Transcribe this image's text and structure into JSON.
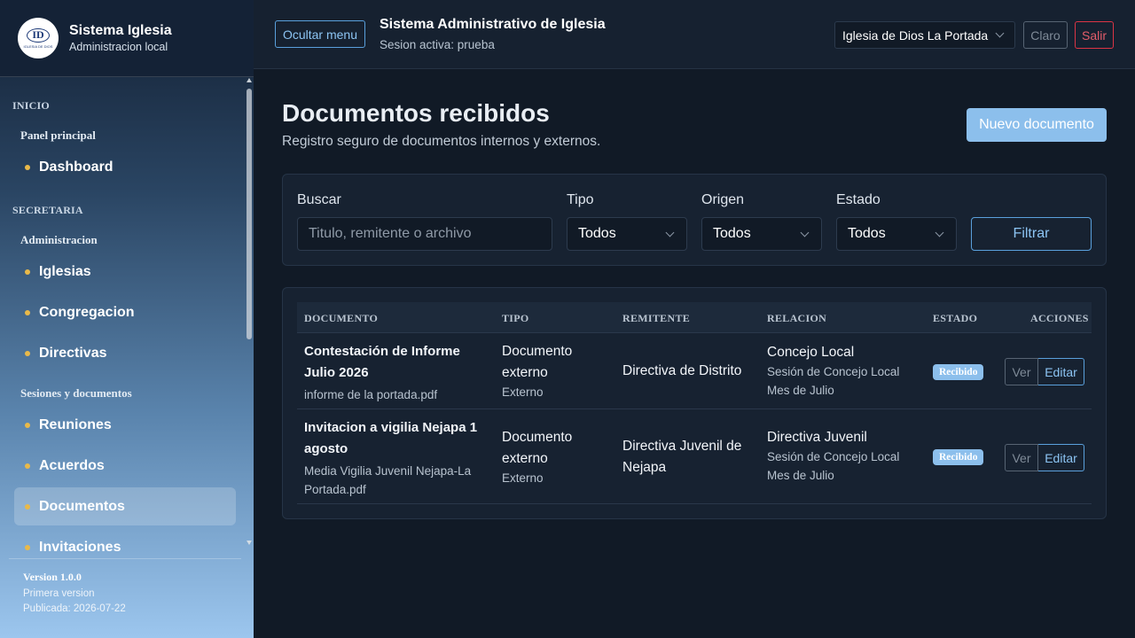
{
  "brand": {
    "title": "Sistema Iglesia",
    "subtitle": "Administracion local",
    "logo_text": "ID",
    "logo_sub": "IGLESIA DE DIOS"
  },
  "sidebar": {
    "sections": [
      {
        "label": "INICIO"
      },
      {
        "label": "SECRETARIA"
      }
    ],
    "groups": [
      {
        "label": "Panel principal"
      },
      {
        "label": "Administracion"
      },
      {
        "label": "Sesiones y documentos"
      }
    ],
    "items": [
      {
        "label": "Dashboard"
      },
      {
        "label": "Iglesias"
      },
      {
        "label": "Congregacion"
      },
      {
        "label": "Directivas"
      },
      {
        "label": "Reuniones"
      },
      {
        "label": "Acuerdos"
      },
      {
        "label": "Documentos"
      },
      {
        "label": "Invitaciones"
      }
    ],
    "active_item": "Documentos"
  },
  "version": {
    "label": "Version 1.0.0",
    "note": "Primera version",
    "published": "Publicada: 2026-07-22"
  },
  "topbar": {
    "toggle_menu": "Ocultar menu",
    "title": "Sistema Administrativo de Iglesia",
    "session": "Sesion activa: prueba",
    "church_select": "Iglesia de Dios La Portada",
    "theme_button": "Claro",
    "logout_button": "Salir"
  },
  "page": {
    "title": "Documentos recibidos",
    "subtitle": "Registro seguro de documentos internos y externos.",
    "new_button": "Nuevo documento"
  },
  "filters": {
    "search_label": "Buscar",
    "search_placeholder": "Titulo, remitente o archivo",
    "tipo_label": "Tipo",
    "tipo_value": "Todos",
    "origen_label": "Origen",
    "origen_value": "Todos",
    "estado_label": "Estado",
    "estado_value": "Todos",
    "filter_button": "Filtrar"
  },
  "table": {
    "headers": [
      "DOCUMENTO",
      "TIPO",
      "REMITENTE",
      "RELACION",
      "ESTADO",
      "ACCIONES"
    ],
    "rows": [
      {
        "title": "Contestación de Informe Julio 2026",
        "file": "informe de la portada.pdf",
        "tipo": "Documento externo",
        "origen": "Externo",
        "remitente": "Directiva de Distrito",
        "relacion": "Concejo Local",
        "relacion_sub1": "Sesión de Concejo Local",
        "relacion_sub2": "Mes de Julio",
        "estado": "Recibido",
        "ver": "Ver",
        "editar": "Editar"
      },
      {
        "title": "Invitacion a vigilia Nejapa 1 agosto",
        "file": "Media Vigilia Juvenil Nejapa-La Portada.pdf",
        "tipo": "Documento externo",
        "origen": "Externo",
        "remitente": "Directiva Juvenil de Nejapa",
        "relacion": "Directiva Juvenil",
        "relacion_sub1": "Sesión de Concejo Local",
        "relacion_sub2": "Mes de Julio",
        "estado": "Recibido",
        "ver": "Ver",
        "editar": "Editar"
      }
    ]
  },
  "colors": {
    "accent": "#8cbfec",
    "danger": "#dc3545",
    "bullet": "#e9b949",
    "background": "#111a26"
  }
}
